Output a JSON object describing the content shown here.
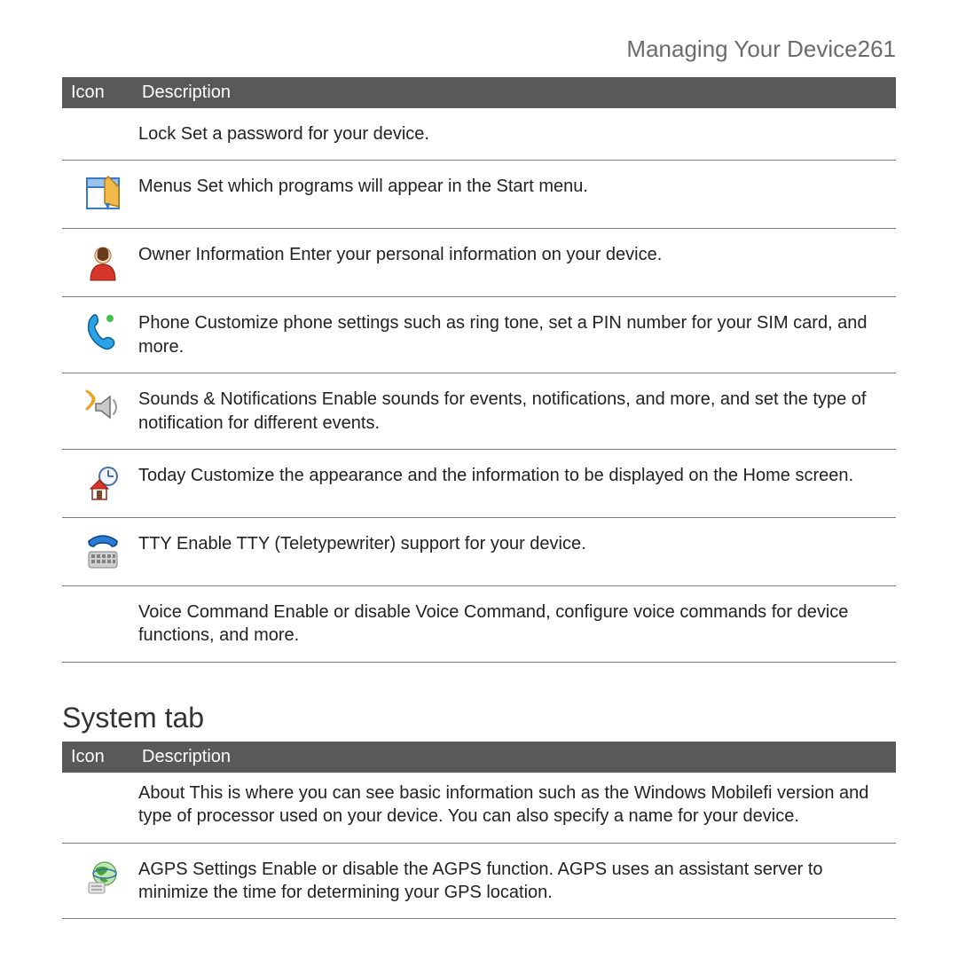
{
  "page_header": {
    "section": "Managing Your Device",
    "page_number": "261"
  },
  "table1": {
    "header": {
      "icon": "Icon",
      "desc": "Description"
    },
    "rows": [
      {
        "icon": "lock-icon",
        "text": "Lock  Set a password for your device."
      },
      {
        "icon": "menus-icon",
        "text": "Menus  Set which programs will appear in the Start menu."
      },
      {
        "icon": "owner-info-icon",
        "text": "Owner Information   Enter your personal information on your device."
      },
      {
        "icon": "phone-icon",
        "text": "Phone  Customize phone settings such as ring tone, set a PIN number for your SIM card, and more."
      },
      {
        "icon": "sounds-icon",
        "text": "Sounds & Notifications  Enable sounds for events, notifications, and more, and set the type of notification for different events."
      },
      {
        "icon": "today-icon",
        "text": "Today  Customize the appearance and the information to be displayed on the Home screen."
      },
      {
        "icon": "tty-icon",
        "text": "TTY Enable TTY (Teletypewriter) support for your device."
      },
      {
        "icon": "voice-command-icon",
        "text": "Voice Command  Enable or disable Voice Command, configure voice commands for device functions, and more."
      }
    ]
  },
  "section2_title": "System tab",
  "table2": {
    "header": {
      "icon": "Icon",
      "desc": "Description"
    },
    "rows": [
      {
        "icon": "about-icon",
        "text": "About   This is where you can see basic information such as the Windows Mobilefi  version and type of processor used on your device. You can also specify a name for your device."
      },
      {
        "icon": "agps-icon",
        "text": "AGPS Settings Enable or disable the AGPS function. AGPS uses an assistant server to minimize the time for determining your GPS location."
      }
    ]
  }
}
